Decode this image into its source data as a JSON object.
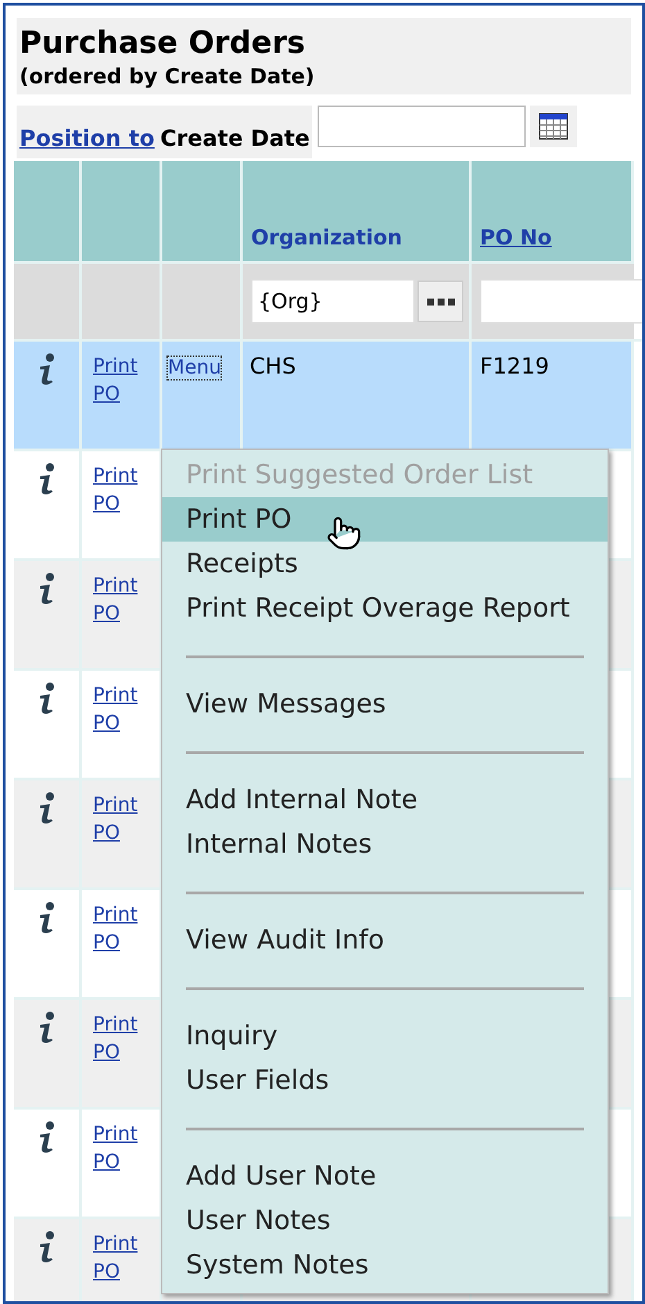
{
  "title": "Purchase Orders",
  "subtitle": "(ordered by Create Date)",
  "position": {
    "link": "Position to",
    "label": "Create Date"
  },
  "table": {
    "columns": [
      {
        "label": "Organization",
        "link": false
      },
      {
        "label": "PO No",
        "link": true
      }
    ],
    "filters": {
      "organization": "{Org}"
    },
    "rows": [
      {
        "selected": true,
        "print_link": "Print PO",
        "menu_link": "Menu",
        "organization": "CHS",
        "po_no": "F1219"
      },
      {
        "selected": false,
        "print_link": "Print PO"
      },
      {
        "selected": false,
        "print_link": "Print PO"
      },
      {
        "selected": false,
        "print_link": "Print PO"
      },
      {
        "selected": false,
        "print_link": "Print PO"
      },
      {
        "selected": false,
        "print_link": "Print PO"
      },
      {
        "selected": false,
        "print_link": "Print PO"
      },
      {
        "selected": false,
        "print_link": "Print PO"
      },
      {
        "selected": false,
        "print_link": "Print PO"
      }
    ]
  },
  "context_menu": [
    {
      "kind": "item",
      "label": "Print Suggested Order List",
      "disabled": true,
      "selected": false
    },
    {
      "kind": "item",
      "label": "Print PO",
      "disabled": false,
      "selected": true
    },
    {
      "kind": "item",
      "label": "Receipts",
      "disabled": false,
      "selected": false
    },
    {
      "kind": "item",
      "label": "Print Receipt Overage Report",
      "disabled": false,
      "selected": false
    },
    {
      "kind": "separator"
    },
    {
      "kind": "item",
      "label": "View Messages",
      "disabled": false,
      "selected": false
    },
    {
      "kind": "separator"
    },
    {
      "kind": "item",
      "label": "Add Internal Note",
      "disabled": false,
      "selected": false
    },
    {
      "kind": "item",
      "label": "Internal Notes",
      "disabled": false,
      "selected": false
    },
    {
      "kind": "separator"
    },
    {
      "kind": "item",
      "label": "View Audit Info",
      "disabled": false,
      "selected": false
    },
    {
      "kind": "separator"
    },
    {
      "kind": "item",
      "label": "Inquiry",
      "disabled": false,
      "selected": false
    },
    {
      "kind": "item",
      "label": "User Fields",
      "disabled": false,
      "selected": false
    },
    {
      "kind": "separator"
    },
    {
      "kind": "item",
      "label": "Add User Note",
      "disabled": false,
      "selected": false
    },
    {
      "kind": "item",
      "label": "User Notes",
      "disabled": false,
      "selected": false
    },
    {
      "kind": "item",
      "label": "System Notes",
      "disabled": false,
      "selected": false
    }
  ]
}
